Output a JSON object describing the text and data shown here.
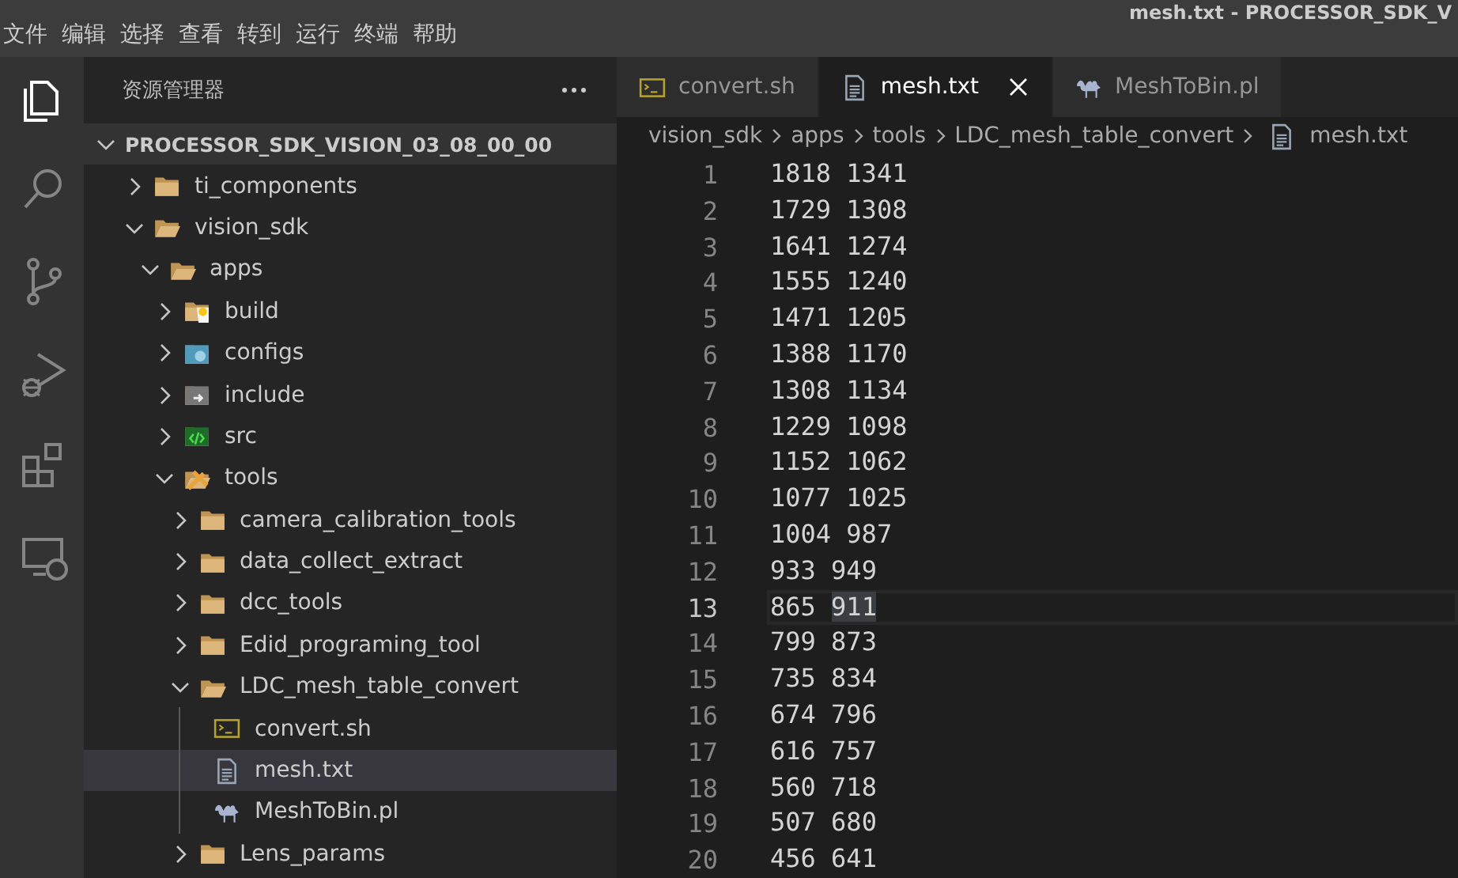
{
  "window": {
    "title": "mesh.txt - PROCESSOR_SDK_V"
  },
  "menu": [
    "文件",
    "编辑",
    "选择",
    "查看",
    "转到",
    "运行",
    "终端",
    "帮助"
  ],
  "activity_bar": [
    {
      "kind": "explorer",
      "selected": true
    },
    {
      "kind": "search",
      "selected": false
    },
    {
      "kind": "source-control",
      "selected": false
    },
    {
      "kind": "debug",
      "selected": false
    },
    {
      "kind": "extensions",
      "selected": false
    },
    {
      "kind": "remote",
      "selected": false
    }
  ],
  "explorer": {
    "title": "资源管理器",
    "root": {
      "label": "PROCESSOR_SDK_VISION_03_08_00_00",
      "expanded": true,
      "children": [
        {
          "label": "ti_components",
          "kind": "folder",
          "expanded": false,
          "selected": false
        },
        {
          "label": "vision_sdk",
          "kind": "folder",
          "expanded": true,
          "selected": false,
          "children": [
            {
              "label": "apps",
              "kind": "folder",
              "expanded": true,
              "selected": false,
              "children": [
                {
                  "label": "build",
                  "kind": "build",
                  "expanded": false,
                  "selected": false
                },
                {
                  "label": "configs",
                  "kind": "config",
                  "expanded": false,
                  "selected": false
                },
                {
                  "label": "include",
                  "kind": "include",
                  "expanded": false,
                  "selected": false
                },
                {
                  "label": "src",
                  "kind": "src",
                  "expanded": false,
                  "selected": false
                },
                {
                  "label": "tools",
                  "kind": "tools",
                  "expanded": true,
                  "selected": false,
                  "children": [
                    {
                      "label": "camera_calibration_tools",
                      "kind": "folder",
                      "expanded": false,
                      "selected": false
                    },
                    {
                      "label": "data_collect_extract",
                      "kind": "folder",
                      "expanded": false,
                      "selected": false
                    },
                    {
                      "label": "dcc_tools",
                      "kind": "folder",
                      "expanded": false,
                      "selected": false
                    },
                    {
                      "label": "Edid_programing_tool",
                      "kind": "folder",
                      "expanded": false,
                      "selected": false
                    },
                    {
                      "label": "LDC_mesh_table_convert",
                      "kind": "folder",
                      "expanded": true,
                      "selected": false,
                      "children": [
                        {
                          "label": "convert.sh",
                          "kind": "shell",
                          "selected": false
                        },
                        {
                          "label": "mesh.txt",
                          "kind": "text",
                          "selected": true
                        },
                        {
                          "label": "MeshToBin.pl",
                          "kind": "perl",
                          "selected": false
                        }
                      ]
                    },
                    {
                      "label": "Lens_params",
                      "kind": "folder",
                      "expanded": false,
                      "selected": false
                    }
                  ]
                }
              ]
            }
          ]
        }
      ]
    }
  },
  "tabs": [
    {
      "label": "convert.sh",
      "kind": "shell",
      "selected": false
    },
    {
      "label": "mesh.txt",
      "kind": "text",
      "selected": true
    },
    {
      "label": "MeshToBin.pl",
      "kind": "perl",
      "selected": false
    }
  ],
  "breadcrumb": [
    {
      "label": "vision_sdk",
      "kind": "folder"
    },
    {
      "label": "apps",
      "kind": "folder"
    },
    {
      "label": "tools",
      "kind": "folder"
    },
    {
      "label": "LDC_mesh_table_convert",
      "kind": "folder"
    },
    {
      "label": "mesh.txt",
      "kind": "text"
    }
  ],
  "lines": [
    {
      "number": "1",
      "current": false,
      "words": [
        {
          "text": "1818",
          "highlighted": false
        },
        {
          "text": "1341",
          "highlighted": false
        }
      ]
    },
    {
      "number": "2",
      "current": false,
      "words": [
        {
          "text": "1729",
          "highlighted": false
        },
        {
          "text": "1308",
          "highlighted": false
        }
      ]
    },
    {
      "number": "3",
      "current": false,
      "words": [
        {
          "text": "1641",
          "highlighted": false
        },
        {
          "text": "1274",
          "highlighted": false
        }
      ]
    },
    {
      "number": "4",
      "current": false,
      "words": [
        {
          "text": "1555",
          "highlighted": false
        },
        {
          "text": "1240",
          "highlighted": false
        }
      ]
    },
    {
      "number": "5",
      "current": false,
      "words": [
        {
          "text": "1471",
          "highlighted": false
        },
        {
          "text": "1205",
          "highlighted": false
        }
      ]
    },
    {
      "number": "6",
      "current": false,
      "words": [
        {
          "text": "1388",
          "highlighted": false
        },
        {
          "text": "1170",
          "highlighted": false
        }
      ]
    },
    {
      "number": "7",
      "current": false,
      "words": [
        {
          "text": "1308",
          "highlighted": false
        },
        {
          "text": "1134",
          "highlighted": false
        }
      ]
    },
    {
      "number": "8",
      "current": false,
      "words": [
        {
          "text": "1229",
          "highlighted": false
        },
        {
          "text": "1098",
          "highlighted": false
        }
      ]
    },
    {
      "number": "9",
      "current": false,
      "words": [
        {
          "text": "1152",
          "highlighted": false
        },
        {
          "text": "1062",
          "highlighted": false
        }
      ]
    },
    {
      "number": "10",
      "current": false,
      "words": [
        {
          "text": "1077",
          "highlighted": false
        },
        {
          "text": "1025",
          "highlighted": false
        }
      ]
    },
    {
      "number": "11",
      "current": false,
      "words": [
        {
          "text": "1004",
          "highlighted": false
        },
        {
          "text": "987",
          "highlighted": false
        }
      ]
    },
    {
      "number": "12",
      "current": false,
      "words": [
        {
          "text": "933",
          "highlighted": false
        },
        {
          "text": "949",
          "highlighted": false
        }
      ]
    },
    {
      "number": "13",
      "current": true,
      "words": [
        {
          "text": "865",
          "highlighted": false
        },
        {
          "text": "911",
          "highlighted": true
        }
      ]
    },
    {
      "number": "14",
      "current": false,
      "words": [
        {
          "text": "799",
          "highlighted": false
        },
        {
          "text": "873",
          "highlighted": false
        }
      ]
    },
    {
      "number": "15",
      "current": false,
      "words": [
        {
          "text": "735",
          "highlighted": false
        },
        {
          "text": "834",
          "highlighted": false
        }
      ]
    },
    {
      "number": "16",
      "current": false,
      "words": [
        {
          "text": "674",
          "highlighted": false
        },
        {
          "text": "796",
          "highlighted": false
        }
      ]
    },
    {
      "number": "17",
      "current": false,
      "words": [
        {
          "text": "616",
          "highlighted": false
        },
        {
          "text": "757",
          "highlighted": false
        }
      ]
    },
    {
      "number": "18",
      "current": false,
      "words": [
        {
          "text": "560",
          "highlighted": false
        },
        {
          "text": "718",
          "highlighted": false
        }
      ]
    },
    {
      "number": "19",
      "current": false,
      "words": [
        {
          "text": "507",
          "highlighted": false
        },
        {
          "text": "680",
          "highlighted": false
        }
      ]
    },
    {
      "number": "20",
      "current": false,
      "words": [
        {
          "text": "456",
          "highlighted": false
        },
        {
          "text": "641",
          "highlighted": false
        }
      ]
    }
  ]
}
